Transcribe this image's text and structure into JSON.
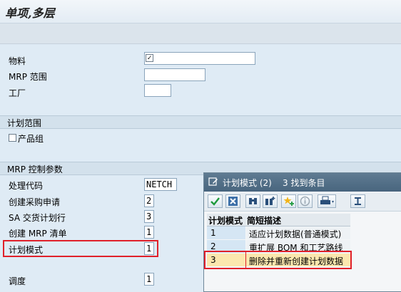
{
  "window": {
    "title": "单项,多层"
  },
  "fields": {
    "material": {
      "label": "物料",
      "value": ""
    },
    "mrp_scope": {
      "label": "MRP 范围",
      "value": ""
    },
    "plant": {
      "label": "工厂",
      "value": ""
    }
  },
  "planning_scope": {
    "header": "计划范围",
    "product_group_label": "产品组"
  },
  "mrp_params": {
    "header": "MRP 控制参数",
    "items": [
      {
        "label": "处理代码",
        "value": "NETCH"
      },
      {
        "label": "创建采购申请",
        "value": "2"
      },
      {
        "label": "SA 交货计划行",
        "value": "3"
      },
      {
        "label": "创建 MRP 清单",
        "value": "1"
      },
      {
        "label": "计划模式",
        "value": "1"
      },
      {
        "label": "调度",
        "value": "1"
      }
    ]
  },
  "popup": {
    "title": "计划模式 (2)",
    "found": "3 找到条目",
    "columns": [
      "计划模式",
      "简短描述"
    ],
    "rows": [
      {
        "code": "1",
        "desc": "适应计划数据(普通模式)"
      },
      {
        "code": "2",
        "desc": "重扩展 BOM 和工艺路线"
      },
      {
        "code": "3",
        "desc": "删除并重新创建计划数据"
      }
    ],
    "selected_row": 3
  },
  "colors": {
    "background": "#dfebf5",
    "highlight_red": "#e0202a",
    "selected_row": "#fbe7ae",
    "popup_title_bg": "#4f6c85"
  }
}
